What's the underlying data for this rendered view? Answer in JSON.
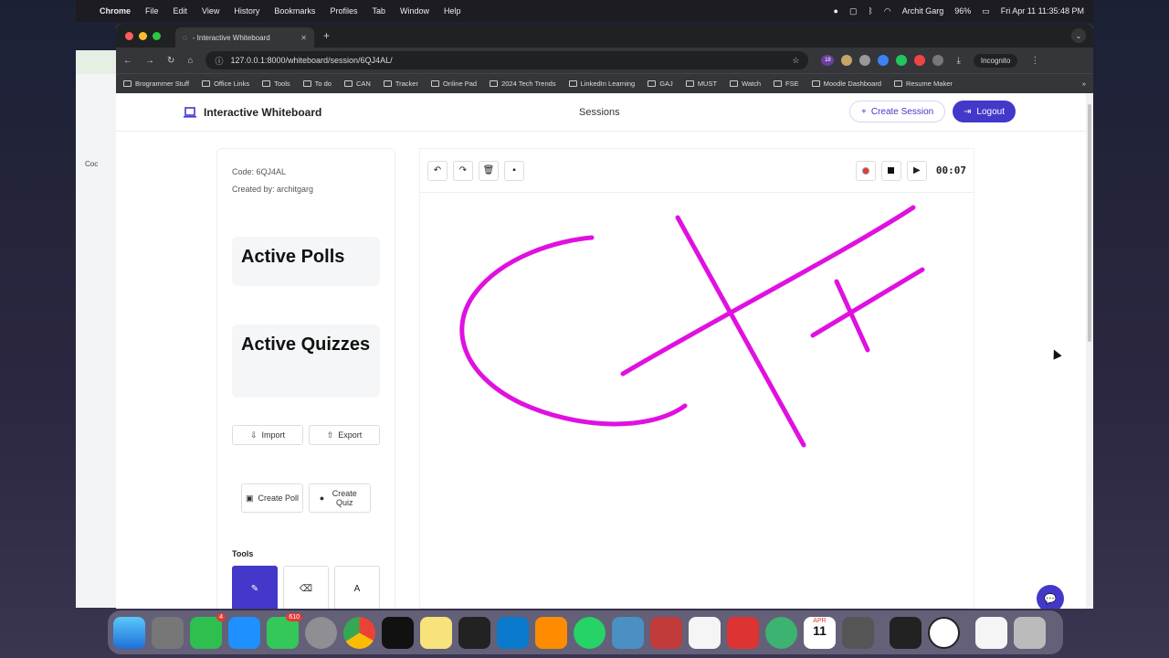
{
  "menubar": {
    "app": "Chrome",
    "items": [
      "File",
      "Edit",
      "View",
      "History",
      "Bookmarks",
      "Profiles",
      "Tab",
      "Window",
      "Help"
    ],
    "user": "Archit Garg",
    "battery": "96%",
    "datetime": "Fri Apr 11  11:35:48 PM"
  },
  "backwin": {
    "label": "Coc"
  },
  "browser": {
    "tab_title": "- Interactive Whiteboard",
    "url": "127.0.0.1:8000/whiteboard/session/6QJ4AL/",
    "incognito": "Incognito",
    "ext_badge": "18",
    "bookmarks": [
      "Brogrammer Stuff",
      "Office Links",
      "Tools",
      "To do",
      "CAN",
      "Tracker",
      "Online Pad",
      "2024 Tech Trends",
      "LinkedIn Learning",
      "GAJ",
      "MUST",
      "Watch",
      "FSE",
      "Moodle Dashboard",
      "Resume Maker"
    ]
  },
  "nav": {
    "brand": "Interactive Whiteboard",
    "sessions": "Sessions",
    "create_session": "Create Session",
    "logout": "Logout"
  },
  "sidebar": {
    "code": "Code: 6QJ4AL",
    "created_by": "Created by: architgarg",
    "polls_title": "Active Polls",
    "quizzes_title": "Active Quizzes",
    "import": "Import",
    "export": "Export",
    "create_poll": "Create Poll",
    "create_quiz": "Create Quiz",
    "tools_label": "Tools",
    "tools": [
      "pen",
      "eraser",
      "text"
    ]
  },
  "board": {
    "timer": "00:07",
    "stroke_color": "#e010e0"
  },
  "dock": {
    "facetime_badge": "4",
    "messages_badge": "610",
    "calendar_month": "APR",
    "calendar_day": "11"
  }
}
